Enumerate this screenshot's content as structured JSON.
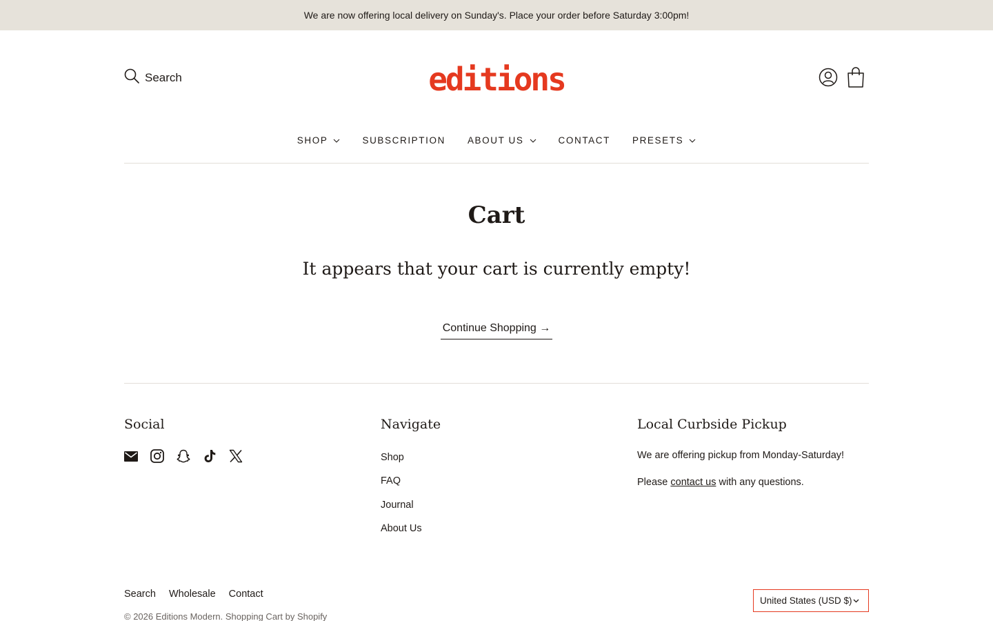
{
  "announcement": "We are now offering local delivery on Sunday's. Place your order before Saturday 3:00pm!",
  "header": {
    "search_label": "Search",
    "logo_text": "editions",
    "brand_color": "#e5391f"
  },
  "nav": [
    {
      "label": "SHOP",
      "has_dropdown": true
    },
    {
      "label": "SUBSCRIPTION",
      "has_dropdown": false
    },
    {
      "label": "ABOUT US",
      "has_dropdown": true
    },
    {
      "label": "CONTACT",
      "has_dropdown": false
    },
    {
      "label": "PRESETS",
      "has_dropdown": true
    }
  ],
  "main": {
    "title": "Cart",
    "empty_message": "It appears that your cart is currently empty!",
    "continue_label": "Continue Shopping →"
  },
  "footer": {
    "social": {
      "heading": "Social",
      "icons": [
        "email-icon",
        "instagram-icon",
        "snapchat-icon",
        "tiktok-icon",
        "x-icon"
      ]
    },
    "navigate": {
      "heading": "Navigate",
      "links": [
        "Shop",
        "FAQ",
        "Journal",
        "About Us"
      ]
    },
    "pickup": {
      "heading": "Local Curbside Pickup",
      "line1": "We are offering pickup from Monday-Saturday!",
      "line2_before": "Please ",
      "line2_link": "contact us",
      "line2_after": " with any questions."
    },
    "bottom_links": [
      "Search",
      "Wholesale",
      "Contact"
    ],
    "copyright": "© 2026 Editions Modern. Shopping Cart by Shopify",
    "currency": "United States (USD $)"
  }
}
